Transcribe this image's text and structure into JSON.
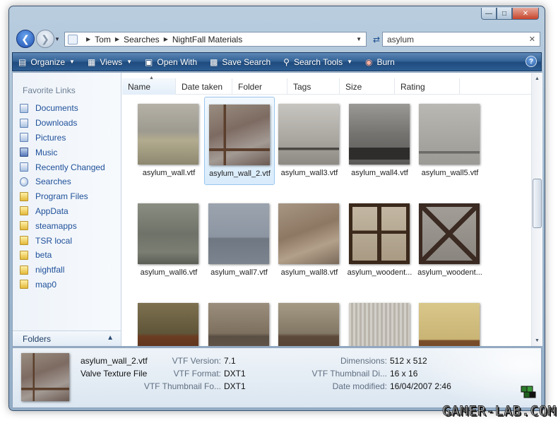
{
  "window": {
    "caption_buttons": [
      "minimize",
      "maximize",
      "close"
    ]
  },
  "nav": {
    "breadcrumbs": [
      "Tom",
      "Searches",
      "NightFall Materials"
    ],
    "search_value": "asylum"
  },
  "toolbar": {
    "organize": "Organize",
    "views": "Views",
    "open_with": "Open With",
    "save_search": "Save Search",
    "search_tools": "Search Tools",
    "burn": "Burn",
    "help": "?"
  },
  "sidebar": {
    "title": "Favorite Links",
    "items": [
      {
        "label": "Documents",
        "icon": "documents-icon"
      },
      {
        "label": "Downloads",
        "icon": "downloads-icon"
      },
      {
        "label": "Pictures",
        "icon": "pictures-icon"
      },
      {
        "label": "Music",
        "icon": "music-icon"
      },
      {
        "label": "Recently Changed",
        "icon": "recent-icon"
      },
      {
        "label": "Searches",
        "icon": "searches-icon"
      },
      {
        "label": "Program Files",
        "icon": "folder-icon"
      },
      {
        "label": "AppData",
        "icon": "folder-icon"
      },
      {
        "label": "steamapps",
        "icon": "folder-icon"
      },
      {
        "label": "TSR local",
        "icon": "folder-icon"
      },
      {
        "label": "beta",
        "icon": "folder-icon"
      },
      {
        "label": "nightfall",
        "icon": "folder-icon"
      },
      {
        "label": "map0",
        "icon": "folder-icon"
      }
    ],
    "folders_label": "Folders"
  },
  "columns": [
    "Name",
    "Date taken",
    "Folder",
    "Tags",
    "Size",
    "Rating"
  ],
  "files": [
    {
      "name": "asylum_wall.vtf",
      "texture": "plaster"
    },
    {
      "name": "asylum_wall_2.vtf",
      "texture": "beams",
      "selected": true
    },
    {
      "name": "asylum_wall3.vtf",
      "texture": "rail"
    },
    {
      "name": "asylum_wall4.vtf",
      "texture": "dark"
    },
    {
      "name": "asylum_wall5.vtf",
      "texture": "grey"
    },
    {
      "name": "asylum_wall6.vtf",
      "texture": "green"
    },
    {
      "name": "asylum_wall7.vtf",
      "texture": "bluegrey"
    },
    {
      "name": "asylum_wall8.vtf",
      "texture": "cracked"
    },
    {
      "name": "asylum_woodent...",
      "texture": "woodenT"
    },
    {
      "name": "asylum_woodent...",
      "texture": "woodenX"
    },
    {
      "name": "",
      "texture": "panel1"
    },
    {
      "name": "",
      "texture": "panel2"
    },
    {
      "name": "",
      "texture": "panel3"
    },
    {
      "name": "",
      "texture": "stripes"
    },
    {
      "name": "",
      "texture": "wallpaper"
    }
  ],
  "details": {
    "name": "asylum_wall_2.vtf",
    "type": "Valve Texture File",
    "props_left": [
      {
        "label": "VTF Version:",
        "value": "7.1"
      },
      {
        "label": "VTF Format:",
        "value": "DXT1"
      },
      {
        "label": "VTF Thumbnail Fo...",
        "value": "DXT1"
      }
    ],
    "props_right": [
      {
        "label": "Dimensions:",
        "value": "512 x 512"
      },
      {
        "label": "VTF Thumbnail Di...",
        "value": "16 x 16"
      },
      {
        "label": "Date modified:",
        "value": "16/04/2007 2:46"
      }
    ]
  },
  "watermark": "GAMER-LAB.COM"
}
